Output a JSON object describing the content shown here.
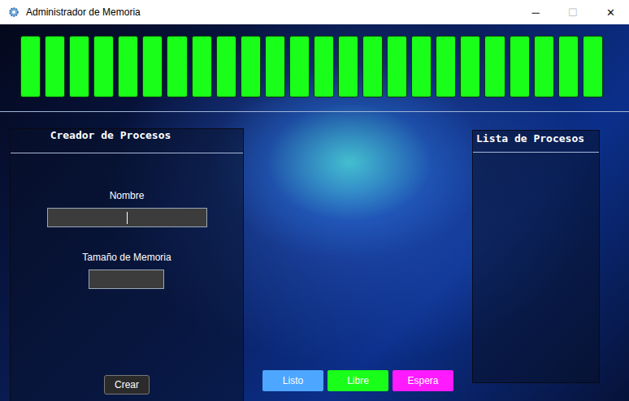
{
  "window": {
    "title": "Administrador de Memoria",
    "controls": [
      "─",
      "☐",
      "✕"
    ]
  },
  "memory": [
    {
      "state": "Libre"
    },
    {
      "state": "Libre"
    },
    {
      "state": "Libre"
    },
    {
      "state": "Libre"
    },
    {
      "state": "Libre"
    },
    {
      "state": "Libre"
    },
    {
      "state": "Libre"
    },
    {
      "state": "Libre"
    },
    {
      "state": "Libre"
    },
    {
      "state": "Libre"
    },
    {
      "state": "Libre"
    },
    {
      "state": "Libre"
    },
    {
      "state": "Libre"
    },
    {
      "state": "Libre"
    },
    {
      "state": "Libre"
    },
    {
      "state": "Libre"
    },
    {
      "state": "Libre"
    },
    {
      "state": "Libre"
    },
    {
      "state": "Libre"
    },
    {
      "state": "Libre"
    },
    {
      "state": "Libre"
    },
    {
      "state": "Libre"
    },
    {
      "state": "Libre"
    },
    {
      "state": "Libre"
    }
  ],
  "creator": {
    "title": "Creador de Procesos",
    "fields": [
      {
        "label": "Nombre",
        "value": "",
        "focused": true,
        "size": "wide"
      },
      {
        "label": "Tamaño de Memoria",
        "value": "",
        "focused": false,
        "size": "narrow"
      }
    ],
    "button": "Crear"
  },
  "process_list": {
    "title": "Lista de Procesos",
    "items": []
  },
  "legend": [
    {
      "label": "Listo",
      "color": "#4da6ff"
    },
    {
      "label": "Libre",
      "color": "#1aff1a"
    },
    {
      "label": "Espera",
      "color": "#ff1aff"
    }
  ]
}
